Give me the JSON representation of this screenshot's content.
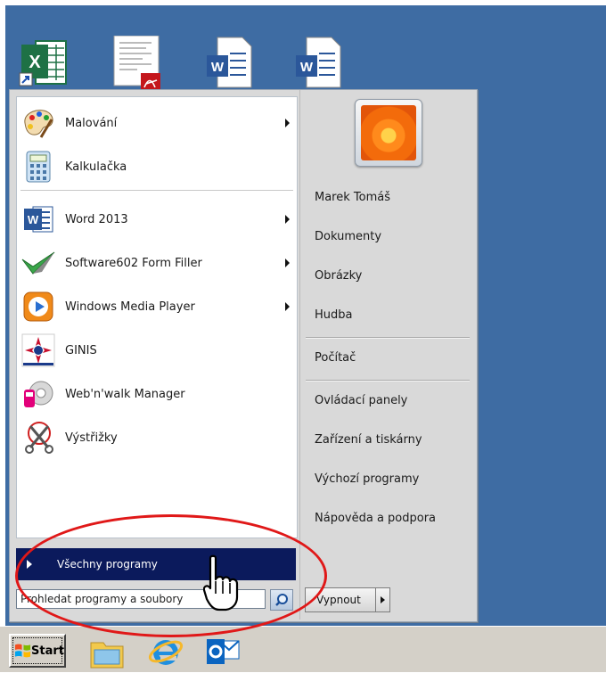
{
  "colors": {
    "desktop": "#3e6ca3",
    "menu_bg": "#d9d9d9",
    "selected": "#0b1a5c",
    "annotation": "#e01818"
  },
  "desktop_icons": [
    {
      "icon": "excel-shortcut-icon"
    },
    {
      "icon": "pdf-document-icon"
    },
    {
      "icon": "word-document-icon"
    },
    {
      "icon": "word-document-icon"
    }
  ],
  "menu": {
    "pinned": [
      {
        "label": "Malování",
        "icon": "paint-icon",
        "submenu": true
      },
      {
        "label": "Kalkulačka",
        "icon": "calculator-icon",
        "submenu": false
      }
    ],
    "recent": [
      {
        "label": "Word 2013",
        "icon": "word-icon",
        "submenu": true
      },
      {
        "label": "Software602 Form Filler",
        "icon": "form-filler-icon",
        "submenu": true
      },
      {
        "label": "Windows Media Player",
        "icon": "media-player-icon",
        "submenu": true
      },
      {
        "label": "GINIS",
        "icon": "ginis-icon",
        "submenu": false
      },
      {
        "label": "Web'n'walk Manager",
        "icon": "webnwalk-icon",
        "submenu": false
      },
      {
        "label": "Výstřižky",
        "icon": "snipping-tool-icon",
        "submenu": false
      }
    ],
    "all_programs": "Všechny programy",
    "search_placeholder": "Prohledat programy a soubory",
    "right": {
      "user": "Marek Tomáš",
      "documents": "Dokumenty",
      "pictures": "Obrázky",
      "music": "Hudba",
      "computer": "Počítač",
      "control_panel": "Ovládací panely",
      "devices": "Zařízení a tiskárny",
      "default_programs": "Výchozí programy",
      "help": "Nápověda a podpora"
    },
    "shutdown": "Vypnout"
  },
  "taskbar": {
    "start": "Start",
    "apps": [
      "file-explorer-icon",
      "internet-explorer-icon",
      "outlook-icon"
    ]
  }
}
